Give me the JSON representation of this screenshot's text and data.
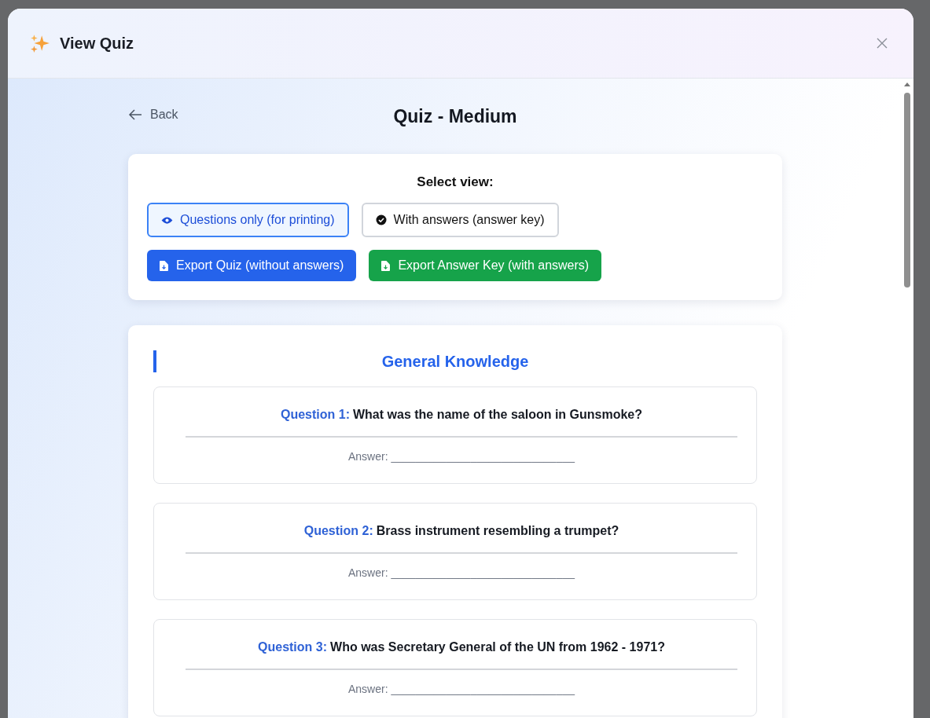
{
  "window": {
    "title": "View Quiz"
  },
  "back": {
    "label": "Back"
  },
  "quiz_title": "Quiz - Medium",
  "view_selector": {
    "heading": "Select view:",
    "options": [
      {
        "label": "Questions only (for printing)",
        "kind": "eye",
        "selected": true
      },
      {
        "label": "With answers (answer key)",
        "kind": "check",
        "selected": false
      }
    ]
  },
  "export_buttons": [
    {
      "label": "Export Quiz (without answers)",
      "kind": "primary"
    },
    {
      "label": "Export Answer Key (with answers)",
      "kind": "success"
    }
  ],
  "section": {
    "title": "General Knowledge",
    "questions": [
      {
        "label": "Question 1:",
        "text": "What was the name of the saloon in Gunsmoke?",
        "answer": "Answer: ______________________________"
      },
      {
        "label": "Question 2:",
        "text": "Brass instrument resembling a trumpet?",
        "answer": "Answer: ______________________________"
      },
      {
        "label": "Question 3:",
        "text": "Who was Secretary General of the UN from 1962 - 1971?",
        "answer": "Answer: ______________________________"
      }
    ]
  }
}
